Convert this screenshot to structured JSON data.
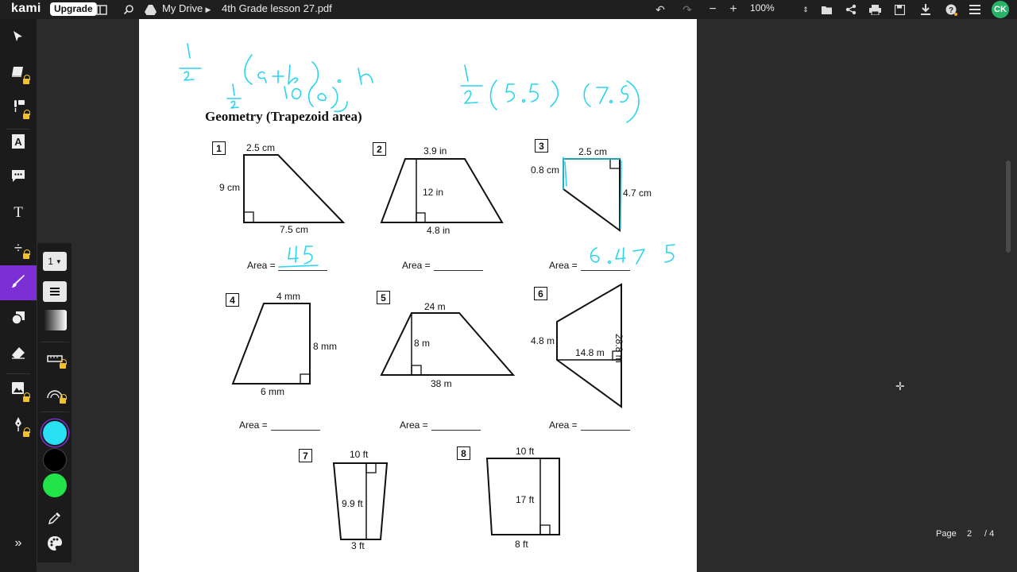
{
  "header": {
    "brand": "kami",
    "upgrade_label": "Upgrade",
    "breadcrumb_root": "My Drive",
    "filename": "4th Grade lesson 27.pdf",
    "zoom_value": "100%",
    "avatar_initials": "CK"
  },
  "tools": {
    "icons": [
      "select-icon",
      "dictionary-icon",
      "comment-voice-icon",
      "text-highlight-icon",
      "comment-icon",
      "text-icon",
      "equation-icon",
      "drawing-icon",
      "shapes-icon",
      "eraser-icon",
      "image-icon",
      "signature-icon",
      "collapse-icon"
    ]
  },
  "drawing_panel": {
    "stroke_width": "1",
    "colors": [
      "#29e0f5",
      "#000000",
      "#22e34a"
    ]
  },
  "document": {
    "title": "Geometry (Trapezoid area)",
    "area_label": "Area =",
    "problems": [
      {
        "num": "1",
        "labels": [
          "2.5 cm",
          "9 cm",
          "7.5 cm"
        ]
      },
      {
        "num": "2",
        "labels": [
          "3.9 in",
          "12 in",
          "4.8 in"
        ]
      },
      {
        "num": "3",
        "labels": [
          "2.5 cm",
          "0.8 cm",
          "4.7 cm"
        ]
      },
      {
        "num": "4",
        "labels": [
          "4 mm",
          "8 mm",
          "6 mm"
        ]
      },
      {
        "num": "5",
        "labels": [
          "24 m",
          "8 m",
          "38 m"
        ]
      },
      {
        "num": "6",
        "labels": [
          "4.8 m",
          "14.8 m",
          "28.8 m"
        ]
      },
      {
        "num": "7",
        "labels": [
          "10 ft",
          "9.9 ft",
          "3 ft"
        ]
      },
      {
        "num": "8",
        "labels": [
          "10 ft",
          "17 ft",
          "8 ft"
        ]
      }
    ],
    "annotation_color": "#29d4f0"
  },
  "page_indicator": {
    "label": "Page",
    "current": "2",
    "total": "/ 4"
  }
}
